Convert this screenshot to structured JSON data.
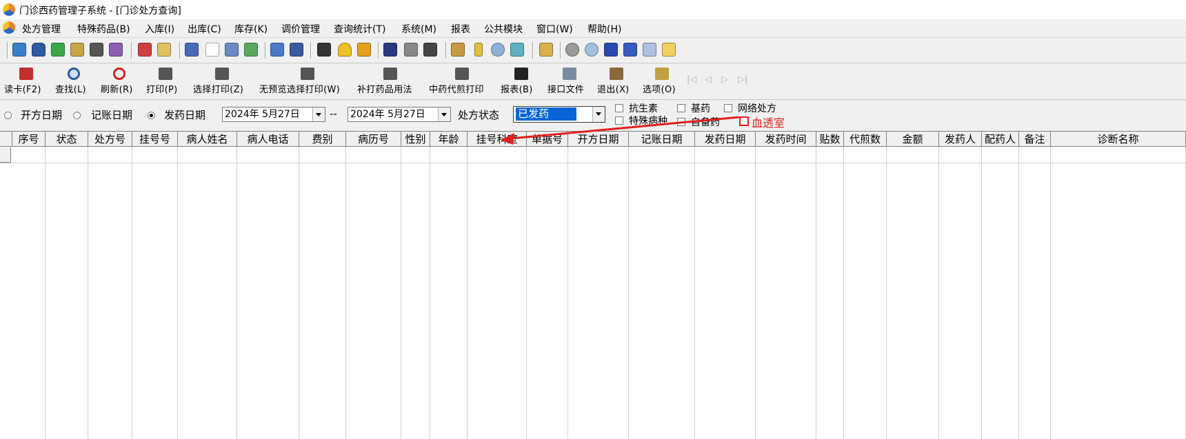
{
  "window": {
    "title": "门诊西药管理子系统 - [门诊处方查询]"
  },
  "menu": [
    "处方管理",
    "特殊药品(B)",
    "入库(I)",
    "出库(C)",
    "库存(K)",
    "调价管理",
    "查询统计(T)",
    "系统(M)",
    "报表",
    "公共模块",
    "窗口(W)",
    "帮助(H)"
  ],
  "actions": {
    "read_card": "读卡(F2)",
    "find": "查找(L)",
    "refresh": "刷新(R)",
    "print": "打印(P)",
    "select_print": "选择打印(Z)",
    "nopreview_print": "无预览选择打印(W)",
    "reprint_usage": "补打药品用法",
    "herbal_decoction_print": "中药代煎打印",
    "report": "报表(B)",
    "interface_file": "接口文件",
    "exit": "退出(X)",
    "options": "选项(O)"
  },
  "filters": {
    "date_open": "开方日期",
    "date_account": "记账日期",
    "date_dispense": "发药日期",
    "date_from": "2024年  5月27日",
    "range_sep": "--",
    "date_to": "2024年  5月27日",
    "status_label": "处方状态",
    "status_value": "已发药",
    "checks": {
      "antibiotic": "抗生素",
      "basic_drug": "基药",
      "online_rx": "网络处方",
      "special_disease": "特殊病种",
      "self_prepared": "自备药",
      "dialysis": "血透室"
    }
  },
  "table": {
    "columns": [
      "序号",
      "状态",
      "处方号",
      "挂号号",
      "病人姓名",
      "病人电话",
      "费别",
      "病历号",
      "性别",
      "年龄",
      "挂号科室",
      "单据号",
      "开方日期",
      "记账日期",
      "发药日期",
      "发药时间",
      "贴数",
      "代煎数",
      "金额",
      "发药人",
      "配药人",
      "备注",
      "诊断名称"
    ]
  },
  "colors": {
    "highlight": "#0a64d8",
    "annotation": "#e0201c"
  }
}
